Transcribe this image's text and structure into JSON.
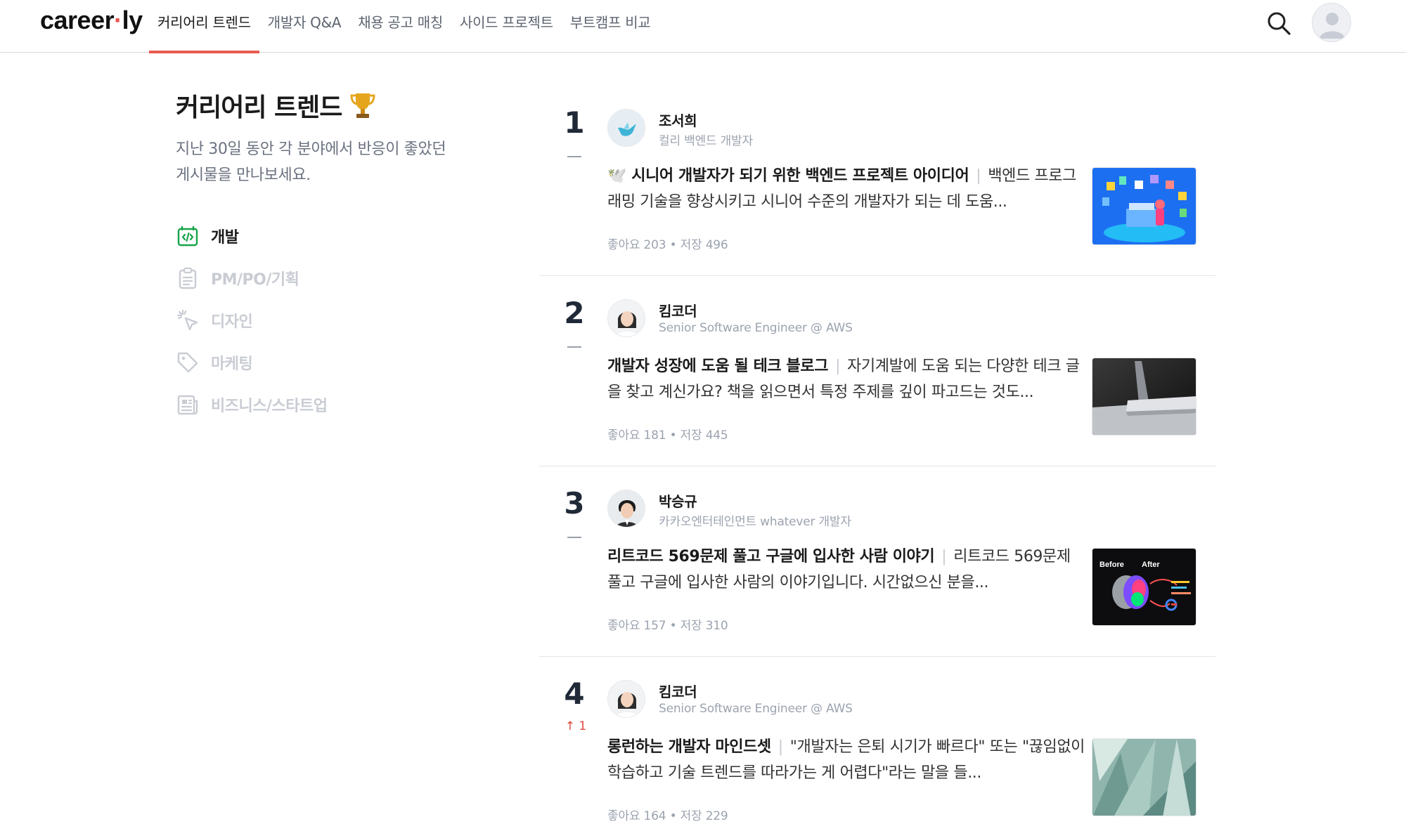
{
  "header": {
    "logo_main": "career",
    "logo_dot": "·",
    "logo_end": "ly",
    "nav": [
      {
        "label": "커리어리 트렌드",
        "active": true
      },
      {
        "label": "개발자 Q&A"
      },
      {
        "label": "채용 공고 매칭"
      },
      {
        "label": "사이드 프로젝트"
      },
      {
        "label": "부트캠프 비교"
      }
    ],
    "search_icon": "search-icon",
    "avatar_icon": "user-avatar-icon"
  },
  "sidebar": {
    "title": "커리어리 트렌드",
    "title_icon": "trophy-icon",
    "description": "지난 30일 동안 각 분야에서 반응이 좋았던\n게시물을 만나보세요.",
    "categories": [
      {
        "label": "개발",
        "icon": "code-icon",
        "active": true
      },
      {
        "label": "PM/PO/기획",
        "icon": "clipboard-icon"
      },
      {
        "label": "디자인",
        "icon": "cursor-click-icon"
      },
      {
        "label": "마케팅",
        "icon": "tag-icon"
      },
      {
        "label": "비즈니스/스타트업",
        "icon": "newspaper-icon"
      }
    ],
    "active_color": "#16a34a"
  },
  "posts": [
    {
      "rank": "1",
      "rank_change": "",
      "author": "조서희",
      "role": "컬리 백엔드 개발자",
      "title": "🕊️ 시니어 개발자가 되기 위한 백엔드 프로젝트 아이디어",
      "snippet": "백엔드 프로그래밍 기술을 향상시키고 시니어 수준의 개발자가 되는 데 도움...",
      "stats": "좋아요 203 • 저장 496"
    },
    {
      "rank": "2",
      "rank_change": "",
      "author": "킴코더",
      "role": "Senior Software Engineer @ AWS",
      "title": "개발자 성장에 도움 될 테크 블로그",
      "snippet": "자기계발에 도움 되는 다양한 테크 글을 찾고 계신가요? 책을 읽으면서 특정 주제를 깊이 파고드는 것도...",
      "stats": "좋아요 181 • 저장 445"
    },
    {
      "rank": "3",
      "rank_change": "",
      "author": "박승규",
      "role": "카카오엔터테인먼트 whatever 개발자",
      "title": "리트코드 569문제 풀고 구글에 입사한 사람 이야기",
      "snippet": "리트코드 569문제 풀고 구글에 입사한 사람의 이야기입니다. 시간없으신 분을...",
      "stats": "좋아요 157 • 저장 310",
      "thumb_before": "Before",
      "thumb_after": "After"
    },
    {
      "rank": "4",
      "rank_change": "↑ 1",
      "author": "킴코더",
      "role": "Senior Software Engineer @ AWS",
      "title": "롱런하는 개발자 마인드셋",
      "snippet": "\"개발자는 은퇴 시기가 빠르다\" 또는 \"끊임없이 학습하고 기술 트렌드를 따라가는 게 어렵다\"라는 말을 들...",
      "stats": "좋아요 164 • 저장 229"
    }
  ],
  "colors": {
    "accent": "#ea5a4f",
    "rank_up": "#e14a3e"
  }
}
